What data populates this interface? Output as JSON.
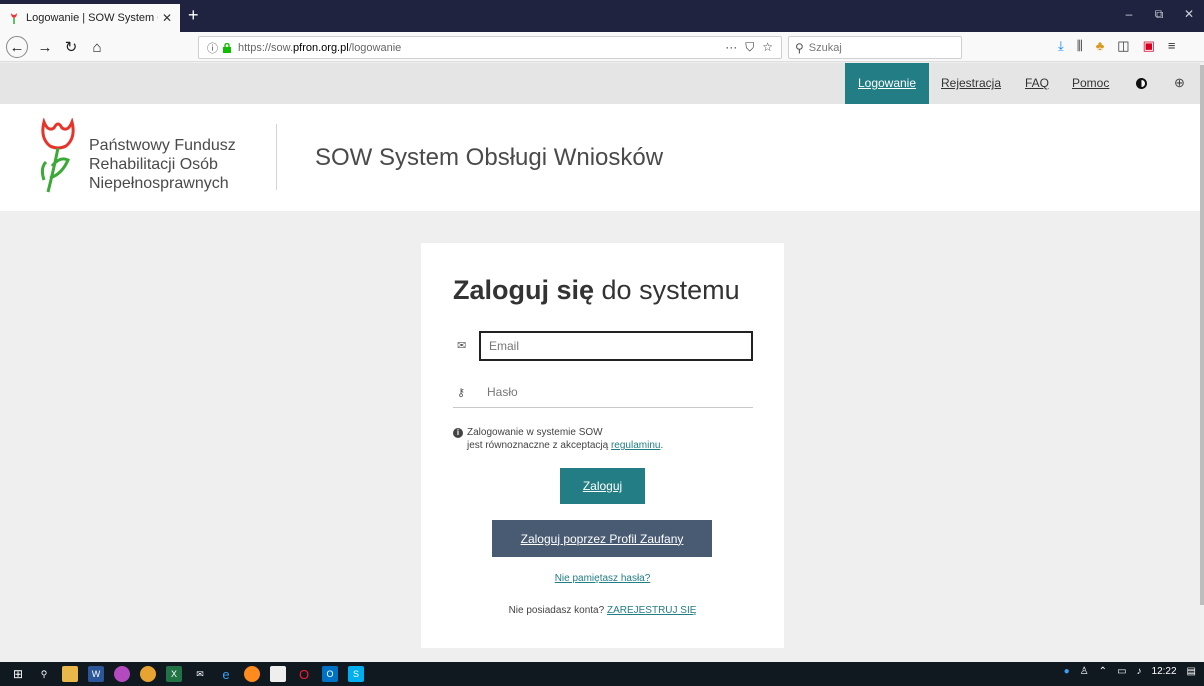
{
  "browser": {
    "tab_title": "Logowanie | SOW System Obsł",
    "tab_close": "✕",
    "new_tab": "+",
    "window_controls": [
      "–",
      "⧉",
      "✕"
    ],
    "url_prefix": "https://sow.",
    "url_domain": "pfron.org.pl",
    "url_path": "/logowanie",
    "url_actions": [
      "···",
      "⛉",
      "☆"
    ],
    "search_placeholder": "Szukaj",
    "icons": [
      "back-icon",
      "forward-icon",
      "reload-icon",
      "home-icon",
      "info-icon",
      "lock-icon",
      "download-icon",
      "library-icon",
      "extension-icon",
      "sidebar-icon",
      "pocket-icon",
      "menu-icon"
    ]
  },
  "site_nav": {
    "login": "Logowanie",
    "register": "Rejestracja",
    "faq": "FAQ",
    "help": "Pomoc"
  },
  "header": {
    "org_line1": "Państwowy Fundusz",
    "org_line2": "Rehabilitacji Osób",
    "org_line3": "Niepełnosprawnych",
    "system_title": "SOW System Obsługi Wniosków"
  },
  "login": {
    "heading_bold": "Zaloguj się",
    "heading_rest": " do systemu",
    "email_placeholder": "Email",
    "password_placeholder": "Hasło",
    "notice_line1": "Zalogowanie w systemie SOW",
    "notice_line2_pre": "jest równoznaczne z akceptacją ",
    "notice_link": "regulaminu",
    "notice_line2_post": ".",
    "submit_label": "Zaloguj",
    "trusted_profile_label": "Zaloguj poprzez Profil Zaufany",
    "forgot_label": "Nie pamiętasz hasła?",
    "no_account_text": "Nie posiadasz konta? ",
    "register_link": "ZAREJESTRUJ SIĘ"
  },
  "taskbar": {
    "clock": "12:22"
  },
  "colors": {
    "accent": "#237d84",
    "trusted_button": "#495a73",
    "tab_bar": "#202340"
  }
}
